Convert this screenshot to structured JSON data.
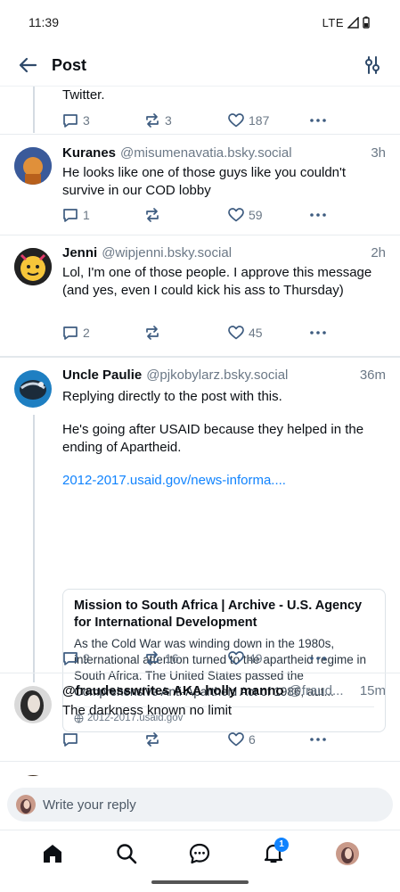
{
  "status_bar": {
    "time": "11:39",
    "network": "LTE"
  },
  "header": {
    "title": "Post"
  },
  "top_fragment": {
    "text": "Twitter.",
    "replies": "3",
    "reposts": "3",
    "likes": "187"
  },
  "posts": [
    {
      "author": "Kuranes",
      "handle": "@misumenavatia.bsky.social",
      "time": "3h",
      "text": "He looks like one of those guys like you couldn't survive in our COD lobby",
      "replies": "1",
      "reposts": "",
      "likes": "59"
    },
    {
      "author": "Jenni",
      "handle": "@wipjenni.bsky.social",
      "time": "2h",
      "text": "Lol, I'm one of those people. I approve this message (and yes, even I could kick his ass to Thursday)",
      "replies": "2",
      "reposts": "",
      "likes": "45"
    },
    {
      "author": "Uncle Paulie",
      "handle": "@pjkobylarz.bsky.social",
      "time": "36m",
      "text_1": "Replying directly to the post with this.",
      "text_2": "He's going after USAID because they helped in the ending of Apartheid.",
      "link": "2012-2017.usaid.gov/news-informa....",
      "card": {
        "title": "Mission to South Africa | Archive - U.S. Agency for International Development",
        "description": "As the Cold War was winding down in the 1980s, international attention turned to the apartheid regime in South Africa. The United States passed the Comprehensive Anti-Apartheid Act of 1986, aut...",
        "domain": "2012-2017.usaid.gov"
      },
      "replies": "2",
      "reposts": "16",
      "likes": "49"
    },
    {
      "author": "@fraudesswrites AKA holly manno",
      "handle": "@fraud...",
      "time": "15m",
      "text": "The darkness known no limit",
      "replies": "",
      "reposts": "",
      "likes": "6"
    }
  ],
  "reply_bar": {
    "placeholder": "Write your reply"
  },
  "bottom_nav": {
    "notifications_badge": "1"
  },
  "colors": {
    "accent": "#1083fe",
    "muted": "#6b7886",
    "thread_line": "#d4dbe2"
  }
}
